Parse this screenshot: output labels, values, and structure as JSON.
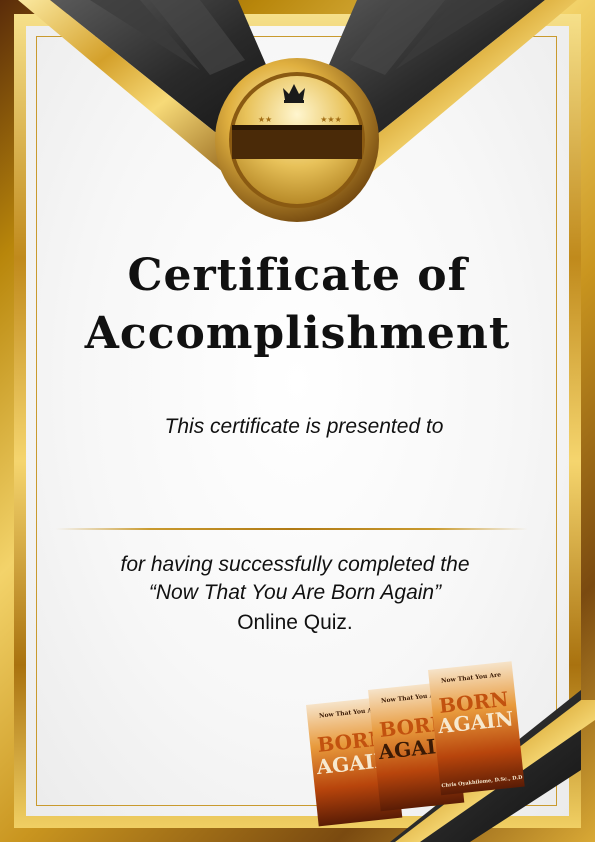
{
  "certificate": {
    "title_line1": "Certificate of",
    "title_line2": "Accomplishment",
    "presented_to": "This certificate is presented to",
    "body_line1": "for having successfully completed the",
    "body_line2": "“Now That You Are Born Again”",
    "body_line3": "Online Quiz."
  },
  "book": {
    "top_line": "Now That You Are",
    "word1": "BORN",
    "word2": "AGAIN",
    "author": "Chris Oyakhilome, D.Sc., D.D"
  },
  "colors": {
    "gold": "#c99a2e",
    "dark_gold": "#7a4a10",
    "text": "#111111",
    "book_orange": "#c2520f"
  }
}
